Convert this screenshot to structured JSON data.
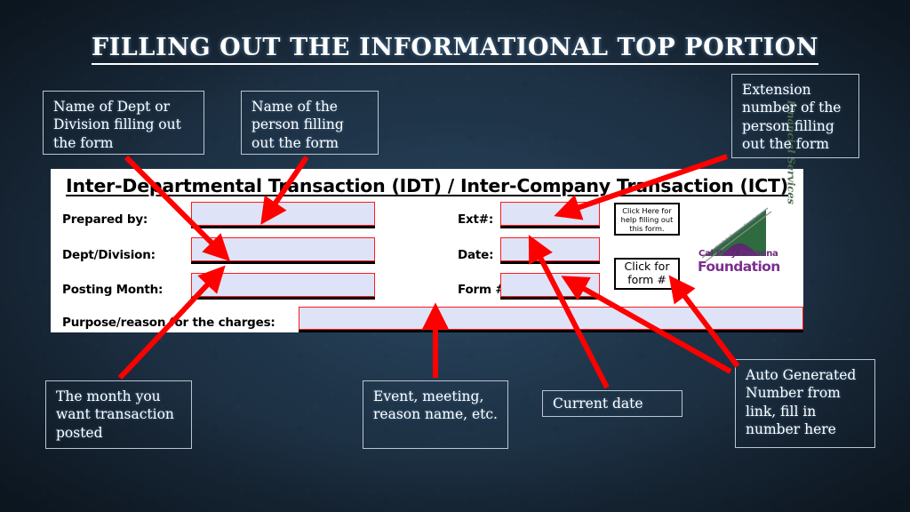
{
  "slide": {
    "title": "FILLING OUT THE INFORMATIONAL TOP PORTION",
    "background_color": "#1a2b3c",
    "accent_color": "#ff1a1a"
  },
  "callouts": [
    {
      "id": "dept-division",
      "text": "Name of Dept or Division filling out the form"
    },
    {
      "id": "person-name",
      "text": "Name of the person filling out the form"
    },
    {
      "id": "extension",
      "text": "Extension number of the person filling out the form"
    },
    {
      "id": "posting-month",
      "text": "The month you want transaction posted"
    },
    {
      "id": "purpose",
      "text": "Event, meeting, reason name, etc."
    },
    {
      "id": "current-date",
      "text": "Current date"
    },
    {
      "id": "form-number",
      "text": "Auto Generated Number from link, fill in number here"
    }
  ],
  "form": {
    "heading": "Inter-Departmental Transaction (IDT) / Inter-Company Transaction (ICT)",
    "field_fill_color": "#dfe3f7",
    "field_border_color": "#ff1a1a",
    "left_fields": [
      {
        "label": "Prepared by:",
        "value": ""
      },
      {
        "label": "Dept/Division:",
        "value": ""
      },
      {
        "label": "Posting Month:",
        "value": ""
      }
    ],
    "right_fields": [
      {
        "label": "Ext#:",
        "value": ""
      },
      {
        "label": "Date:",
        "value": ""
      },
      {
        "label": "Form #:",
        "value": ""
      }
    ],
    "purpose_row": {
      "label": "Purpose/reason for the charges:",
      "value": ""
    },
    "buttons": [
      {
        "id": "help-button",
        "text": "Click Here for help filling out this form."
      },
      {
        "id": "form-num-button",
        "text": "Click for form #"
      }
    ],
    "logo": {
      "line1": "Cal Poly Pomona",
      "line2": "Foundation",
      "vertical": "Financial Services",
      "green": "#2e6b3f",
      "purple": "#7b2f8f"
    }
  }
}
